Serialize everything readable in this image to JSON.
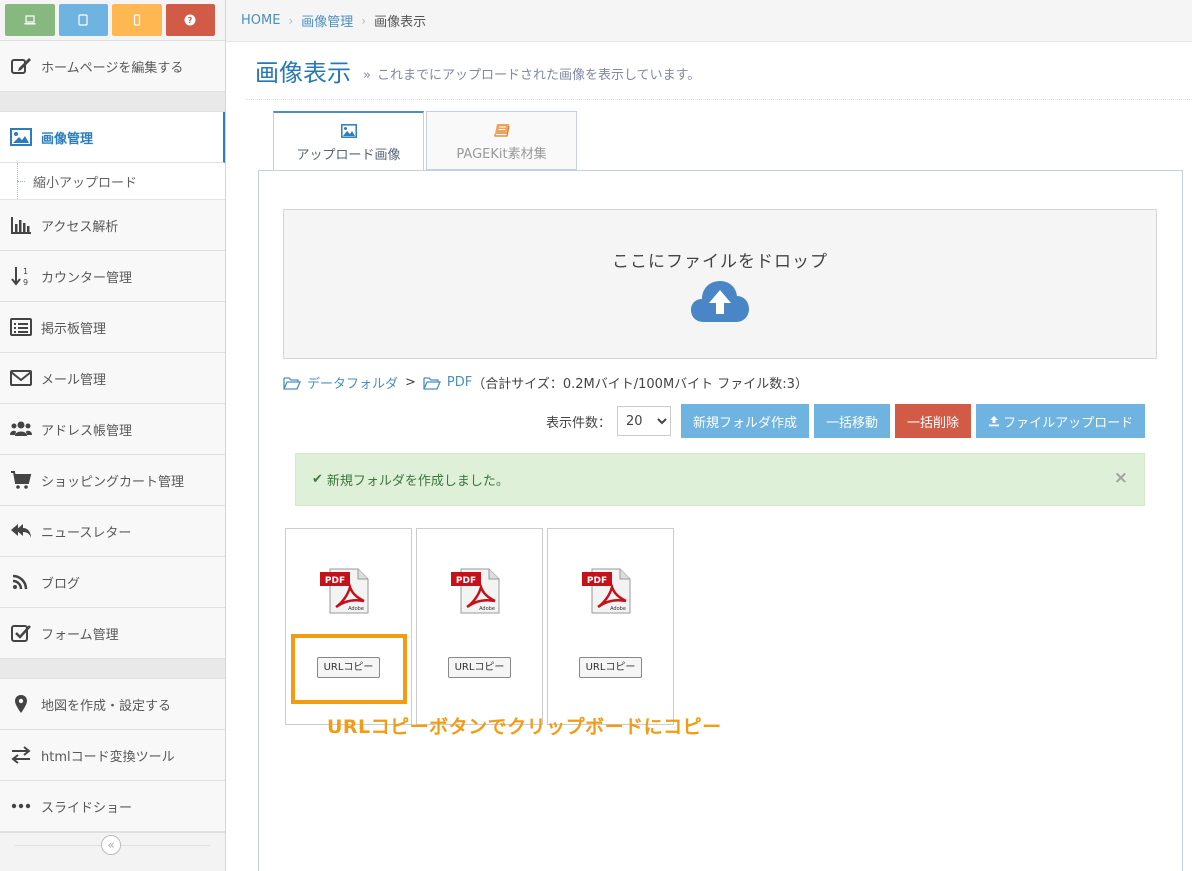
{
  "sidebar": {
    "top_buttons": [
      {
        "icon": "laptop-icon",
        "color": "#87b87f"
      },
      {
        "icon": "tablet-icon",
        "color": "#6fb3e0"
      },
      {
        "icon": "mobile-icon",
        "color": "#ffb752"
      },
      {
        "icon": "question-icon",
        "color": "#d15b47"
      }
    ],
    "items": {
      "edit": "ホームページを編集する",
      "images": "画像管理",
      "shrink_upload": "縮小アップロード",
      "access": "アクセス解析",
      "counter": "カウンター管理",
      "bbs": "掲示板管理",
      "mail": "メール管理",
      "address": "アドレス帳管理",
      "cart": "ショッピングカート管理",
      "newsletter": "ニュースレター",
      "blog": "ブログ",
      "form": "フォーム管理",
      "map": "地図を作成・設定する",
      "html_tool": "htmlコード変換ツール",
      "slideshow": "スライドショー"
    },
    "collapse": "«"
  },
  "breadcrumbs": {
    "home": "HOME",
    "sep": "›",
    "images": "画像管理",
    "current": "画像表示"
  },
  "header": {
    "title": "画像表示",
    "raquo": "»",
    "subtitle": "これまでにアップロードされた画像を表示しています。"
  },
  "tabs": {
    "uploaded": "アップロード画像",
    "pagekit": "PAGEKit素材集"
  },
  "dropzone": {
    "text": "ここにファイルをドロップ"
  },
  "folder_path": {
    "root": "データフォルダ",
    "gt": ">",
    "current": "PDF",
    "info": "（合計サイズ：0.2Mバイト/100Mバイト ファイル数:3）"
  },
  "toolbar": {
    "per_page_label": "表示件数：",
    "per_page_value": "20",
    "new_folder": "新規フォルダ作成",
    "bulk_move": "一括移動",
    "bulk_delete": "一括削除",
    "upload": "ファイルアップロード"
  },
  "alert": {
    "check": "✔",
    "message": "新規フォルダを作成しました。",
    "close": "×"
  },
  "files": [
    {
      "type": "PDF",
      "brand": "Adobe",
      "button": "URLコピー"
    },
    {
      "type": "PDF",
      "brand": "Adobe",
      "button": "URLコピー"
    },
    {
      "type": "PDF",
      "brand": "Adobe",
      "button": "URLコピー"
    }
  ],
  "annotation": "URLコピーボタンでクリップボードにコピー",
  "colors": {
    "accent": "#2679b5",
    "info_button": "#6fb3e0",
    "danger_button": "#d15b47",
    "highlight": "#f39c12",
    "success_bg": "#dff0d8"
  }
}
